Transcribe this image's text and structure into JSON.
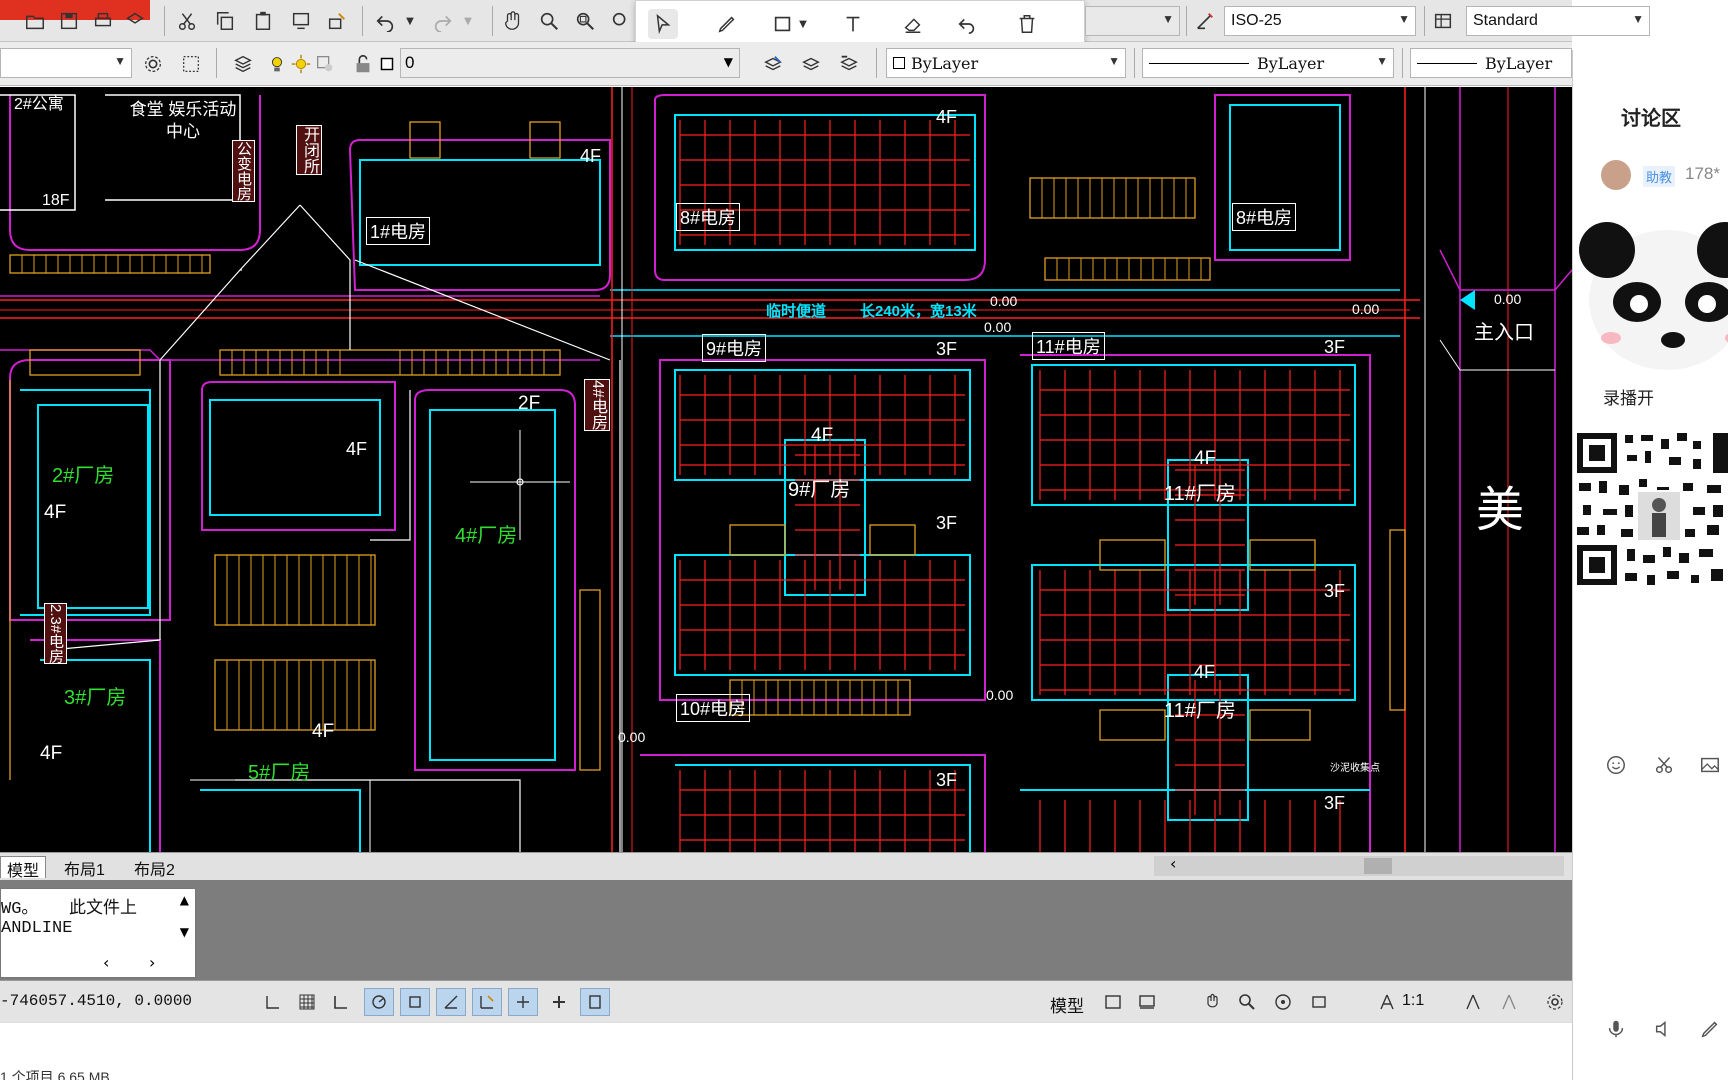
{
  "toolbar": {
    "dimstyle": "ISO-25",
    "textstyle": "Standard"
  },
  "props": {
    "layer_value": "0",
    "color": "ByLayer",
    "linetype": "ByLayer",
    "lineweight": "ByLayer"
  },
  "drawing": {
    "buildings": [
      {
        "name": "2#公寓",
        "floor": "18F"
      },
      {
        "name": "食堂 娱乐活动中心",
        "floor": ""
      },
      {
        "name": "2#厂房",
        "floor": "4F"
      },
      {
        "name": "3#厂房",
        "floor": "4F"
      },
      {
        "name": "4#厂房",
        "floor": "2F"
      },
      {
        "name": "5#厂房",
        "floor": "4F"
      },
      {
        "name": "9#厂房",
        "floor": "4F"
      },
      {
        "name": "11#厂房",
        "floor": "4F"
      }
    ],
    "rooms": [
      "1#电房",
      "8#电房",
      "8#电房",
      "9#电房",
      "10#电房",
      "11#电房",
      "开闭所",
      "4#电房",
      "2.3#电房",
      "公变电房"
    ],
    "floor_tags": [
      "4F",
      "4F",
      "4F",
      "3F",
      "3F",
      "3F",
      "3F",
      "3F",
      "3F",
      "4F",
      "4F",
      "4F"
    ],
    "road_label": "临时便道",
    "road_size": "长240米，宽13米",
    "elevations": [
      "0.00",
      "0.00",
      "0.00",
      "0.00",
      "0.00",
      "0.00"
    ],
    "entrance": "主入口",
    "side_char": "美",
    "misc_label": "沙泥收集点"
  },
  "tabs": [
    "模型",
    "布局1",
    "布局2"
  ],
  "command": {
    "line1": "WG。   此文件上",
    "line2": "ANDLINE"
  },
  "status": {
    "coords": "-746057.4510,  0.0000",
    "model": "模型",
    "scale": "1:1"
  },
  "footer": {
    "items": "1 个项目  6.65 MB"
  },
  "sidebar": {
    "title": "讨论区",
    "badge": "助教",
    "count": "178*",
    "record": "录播开"
  }
}
